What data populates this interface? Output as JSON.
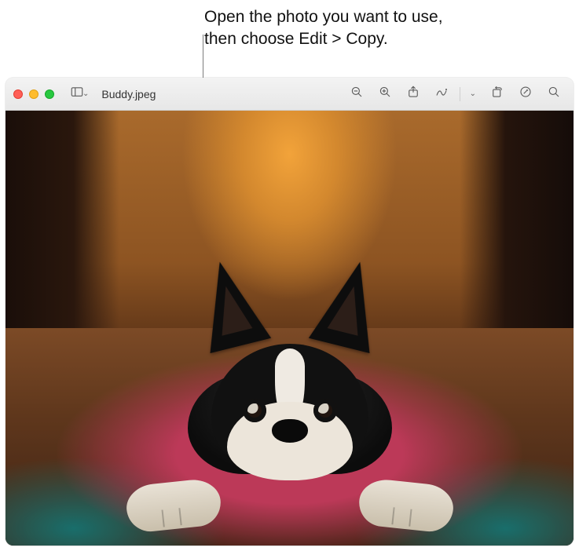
{
  "callout": {
    "line1": "Open the photo you want to use,",
    "line2": "then choose Edit > Copy."
  },
  "window": {
    "title": "Buddy.jpeg"
  },
  "toolbar_icons": {
    "sidebar": "sidebar-icon",
    "sidebar_menu": "chevron-down-icon",
    "zoom_out": "zoom-out-icon",
    "zoom_in": "zoom-in-icon",
    "share": "share-icon",
    "markup": "markup-icon",
    "markup_menu": "chevron-down-icon",
    "rotate": "rotate-icon",
    "edit": "edit-icon",
    "search": "search-icon"
  }
}
